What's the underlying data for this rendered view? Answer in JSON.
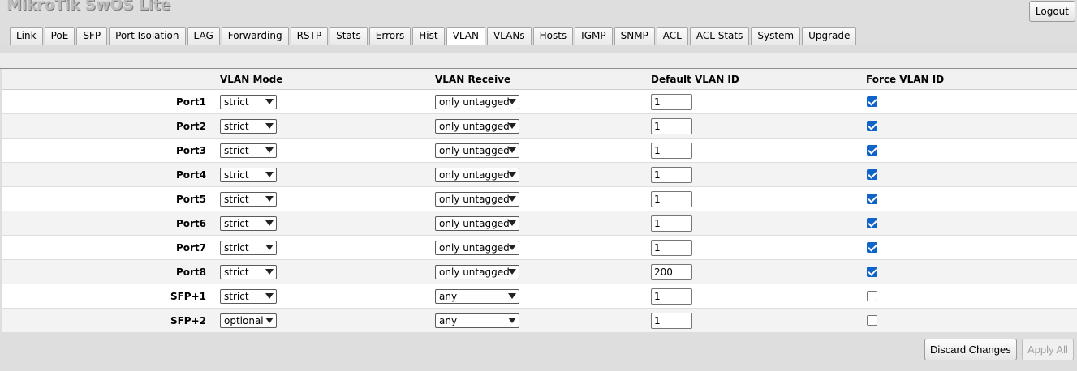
{
  "app": {
    "title": "MikroTik SwOS Lite",
    "logout_label": "Logout"
  },
  "tabs": [
    {
      "label": "Link",
      "active": false
    },
    {
      "label": "PoE",
      "active": false
    },
    {
      "label": "SFP",
      "active": false
    },
    {
      "label": "Port Isolation",
      "active": false
    },
    {
      "label": "LAG",
      "active": false
    },
    {
      "label": "Forwarding",
      "active": false
    },
    {
      "label": "RSTP",
      "active": false
    },
    {
      "label": "Stats",
      "active": false
    },
    {
      "label": "Errors",
      "active": false
    },
    {
      "label": "Hist",
      "active": false
    },
    {
      "label": "VLAN",
      "active": true
    },
    {
      "label": "VLANs",
      "active": false
    },
    {
      "label": "Hosts",
      "active": false
    },
    {
      "label": "IGMP",
      "active": false
    },
    {
      "label": "SNMP",
      "active": false
    },
    {
      "label": "ACL",
      "active": false
    },
    {
      "label": "ACL Stats",
      "active": false
    },
    {
      "label": "System",
      "active": false
    },
    {
      "label": "Upgrade",
      "active": false
    }
  ],
  "table": {
    "headers": {
      "vlan_mode": "VLAN Mode",
      "vlan_receive": "VLAN Receive",
      "default_vlan_id": "Default VLAN ID",
      "force_vlan_id": "Force VLAN ID"
    },
    "rows": [
      {
        "port": "Port1",
        "vlan_mode": "strict",
        "vlan_receive": "only untagged",
        "default_vlan_id": "1",
        "force_vlan_id": true
      },
      {
        "port": "Port2",
        "vlan_mode": "strict",
        "vlan_receive": "only untagged",
        "default_vlan_id": "1",
        "force_vlan_id": true
      },
      {
        "port": "Port3",
        "vlan_mode": "strict",
        "vlan_receive": "only untagged",
        "default_vlan_id": "1",
        "force_vlan_id": true
      },
      {
        "port": "Port4",
        "vlan_mode": "strict",
        "vlan_receive": "only untagged",
        "default_vlan_id": "1",
        "force_vlan_id": true
      },
      {
        "port": "Port5",
        "vlan_mode": "strict",
        "vlan_receive": "only untagged",
        "default_vlan_id": "1",
        "force_vlan_id": true
      },
      {
        "port": "Port6",
        "vlan_mode": "strict",
        "vlan_receive": "only untagged",
        "default_vlan_id": "1",
        "force_vlan_id": true
      },
      {
        "port": "Port7",
        "vlan_mode": "strict",
        "vlan_receive": "only untagged",
        "default_vlan_id": "1",
        "force_vlan_id": true
      },
      {
        "port": "Port8",
        "vlan_mode": "strict",
        "vlan_receive": "only untagged",
        "default_vlan_id": "200",
        "force_vlan_id": true
      },
      {
        "port": "SFP+1",
        "vlan_mode": "strict",
        "vlan_receive": "any",
        "default_vlan_id": "1",
        "force_vlan_id": false
      },
      {
        "port": "SFP+2",
        "vlan_mode": "optional",
        "vlan_receive": "any",
        "default_vlan_id": "1",
        "force_vlan_id": false
      }
    ]
  },
  "footer": {
    "discard_label": "Discard Changes",
    "apply_label": "Apply All"
  },
  "colors": {
    "checkbox_accent": "#0f63c9",
    "title_text": "#bdbdbd"
  }
}
